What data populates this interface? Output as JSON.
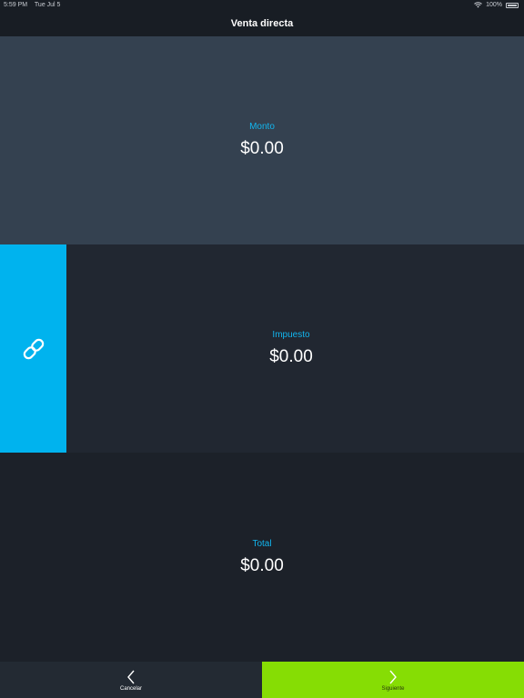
{
  "status_bar": {
    "time": "5:59 PM",
    "date": "Tue Jul 5",
    "battery": "100%"
  },
  "nav": {
    "title": "Venta directa"
  },
  "monto": {
    "label": "Monto",
    "value": "$0.00"
  },
  "impuesto": {
    "label": "Impuesto",
    "value": "$0.00",
    "link_icon": "link-icon"
  },
  "total": {
    "label": "Total",
    "value": "$0.00"
  },
  "bottom": {
    "cancel_label": "Cancelar",
    "cancel_icon": "chevron-left-icon",
    "next_label": "Siguiente",
    "next_icon": "chevron-right-icon"
  },
  "colors": {
    "accent_blue": "#00b3ee",
    "accent_green": "#86dd04"
  }
}
